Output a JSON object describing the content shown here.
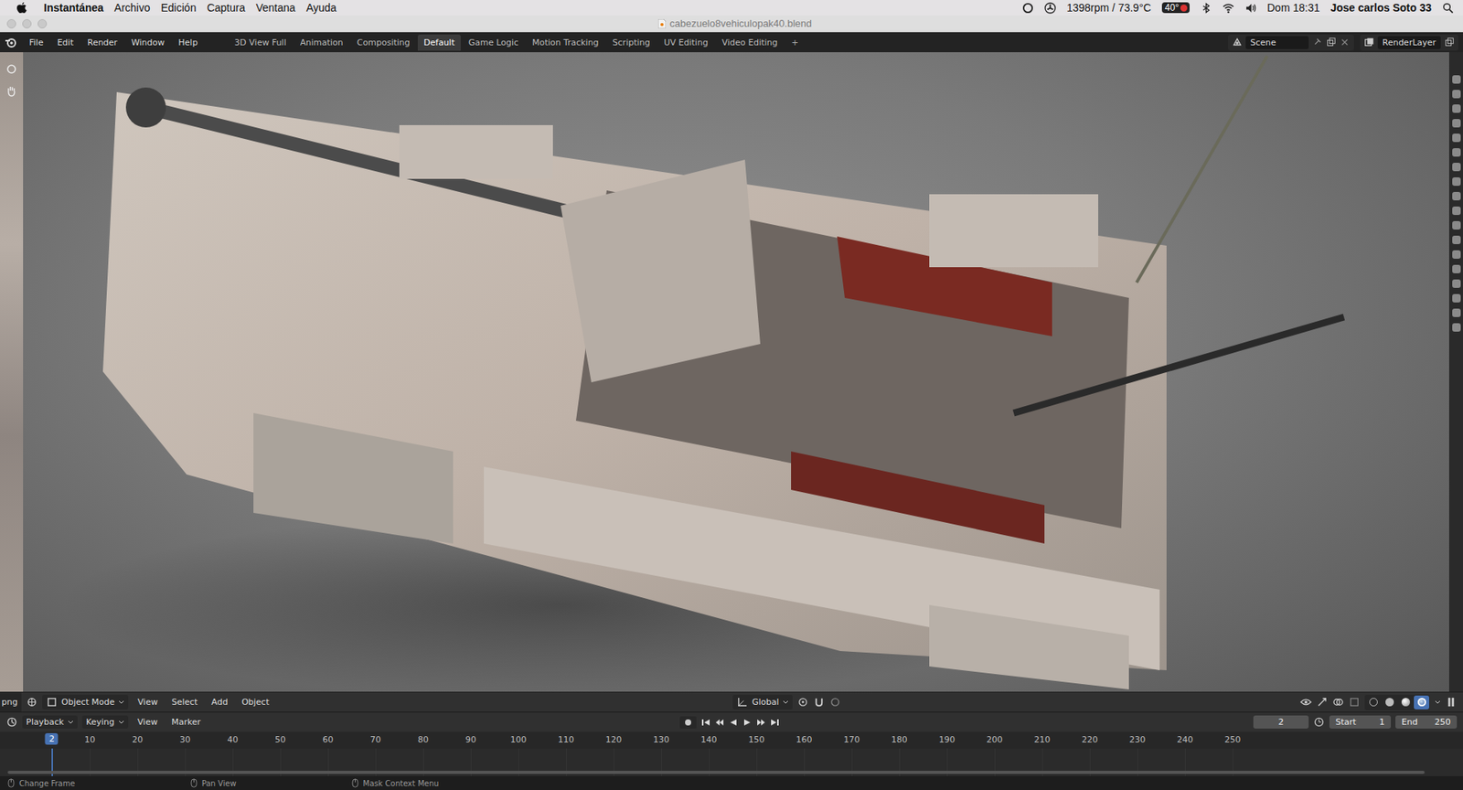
{
  "mac_menubar": {
    "app": "Instantánea",
    "menus": [
      "Archivo",
      "Edición",
      "Captura",
      "Ventana",
      "Ayuda"
    ],
    "status": {
      "fan": "1398rpm / 73.9°C",
      "temp": "40°",
      "clock": "Dom 18:31",
      "user": "Jose carlos Soto 33"
    }
  },
  "window": {
    "title": "cabezuelo8vehiculopak40.blend"
  },
  "topbar": {
    "menus": [
      "File",
      "Edit",
      "Render",
      "Window",
      "Help"
    ],
    "workspaces": [
      {
        "label": "3D View Full",
        "selected": false
      },
      {
        "label": "Animation",
        "selected": false
      },
      {
        "label": "Compositing",
        "selected": false
      },
      {
        "label": "Default",
        "selected": true
      },
      {
        "label": "Game Logic",
        "selected": false
      },
      {
        "label": "Motion Tracking",
        "selected": false
      },
      {
        "label": "Scripting",
        "selected": false
      },
      {
        "label": "UV Editing",
        "selected": false
      },
      {
        "label": "Video Editing",
        "selected": false
      }
    ],
    "add_tab": "+",
    "scene": "Scene",
    "view_layer": "RenderLayer"
  },
  "viewport_header": {
    "left_editor": "png",
    "mode": "Object Mode",
    "menus": [
      "View",
      "Select",
      "Add",
      "Object"
    ],
    "orientation": "Global",
    "shading": [
      {
        "mode": "wireframe",
        "selected": false
      },
      {
        "mode": "solid",
        "selected": false
      },
      {
        "mode": "material",
        "selected": false
      },
      {
        "mode": "rendered",
        "selected": true
      }
    ]
  },
  "timeline": {
    "menus": [
      "Playback",
      "Keying",
      "View",
      "Marker"
    ],
    "current_frame": "2",
    "start_label": "Start",
    "start": "1",
    "end_label": "End",
    "end": "250",
    "playhead": "2",
    "ticks": [
      "10",
      "20",
      "30",
      "40",
      "50",
      "60",
      "70",
      "80",
      "90",
      "100",
      "110",
      "120",
      "130",
      "140",
      "150",
      "160",
      "170",
      "180",
      "190",
      "200",
      "210",
      "220",
      "230",
      "240",
      "250"
    ]
  },
  "status_bar": [
    "Change Frame",
    "Pan View",
    "Mask Context Menu"
  ]
}
